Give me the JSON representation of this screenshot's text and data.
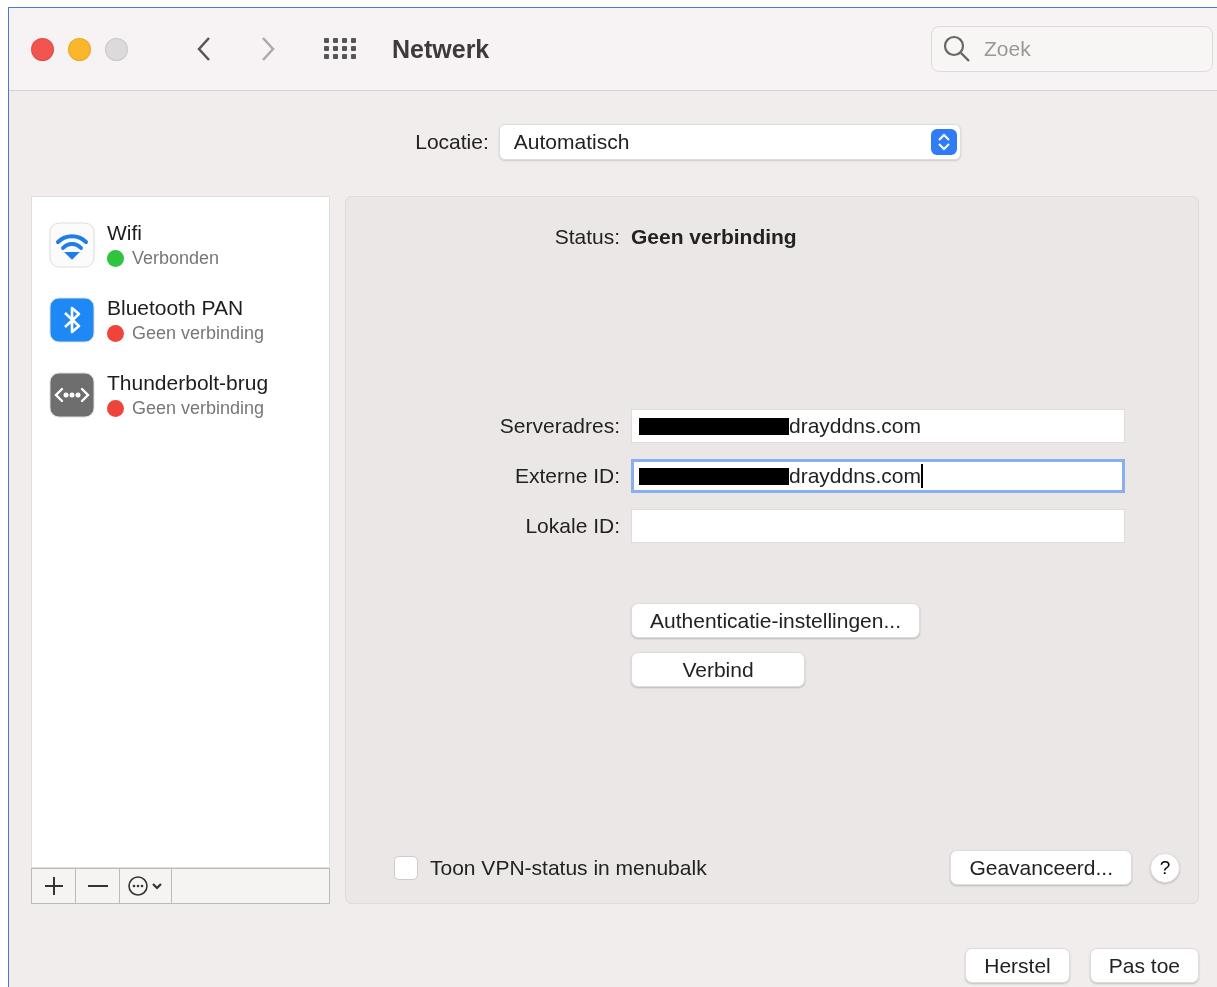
{
  "window": {
    "title": "Netwerk"
  },
  "search": {
    "placeholder": "Zoek"
  },
  "location": {
    "label": "Locatie:",
    "value": "Automatisch"
  },
  "services": [
    {
      "kind": "wifi",
      "name": "Wifi",
      "status": "Verbonden",
      "color": "#2ec43f"
    },
    {
      "kind": "bluetooth",
      "name": "Bluetooth PAN",
      "status": "Geen verbinding",
      "color": "#f0443a"
    },
    {
      "kind": "bridge",
      "name": "Thunderbolt-brug",
      "status": "Geen verbinding",
      "color": "#f0443a"
    }
  ],
  "status": {
    "label": "Status:",
    "value": "Geen verbinding"
  },
  "fields": [
    {
      "label": "Serveradres:",
      "value": "drayddns.com",
      "redacted": true,
      "focused": false
    },
    {
      "label": "Externe ID:",
      "value": "drayddns.com",
      "redacted": true,
      "focused": true
    },
    {
      "label": "Lokale ID:",
      "redacted": false,
      "focused": false
    }
  ],
  "actions": [
    "Authenticatie-instellingen...",
    "Verbind"
  ],
  "vpn_checkbox": {
    "label": "Toon VPN-status in menubalk",
    "checked": false
  },
  "advanced_button": "Geavanceerd...",
  "help_button": "?",
  "footer_buttons": [
    "Herstel",
    "Pas toe"
  ]
}
